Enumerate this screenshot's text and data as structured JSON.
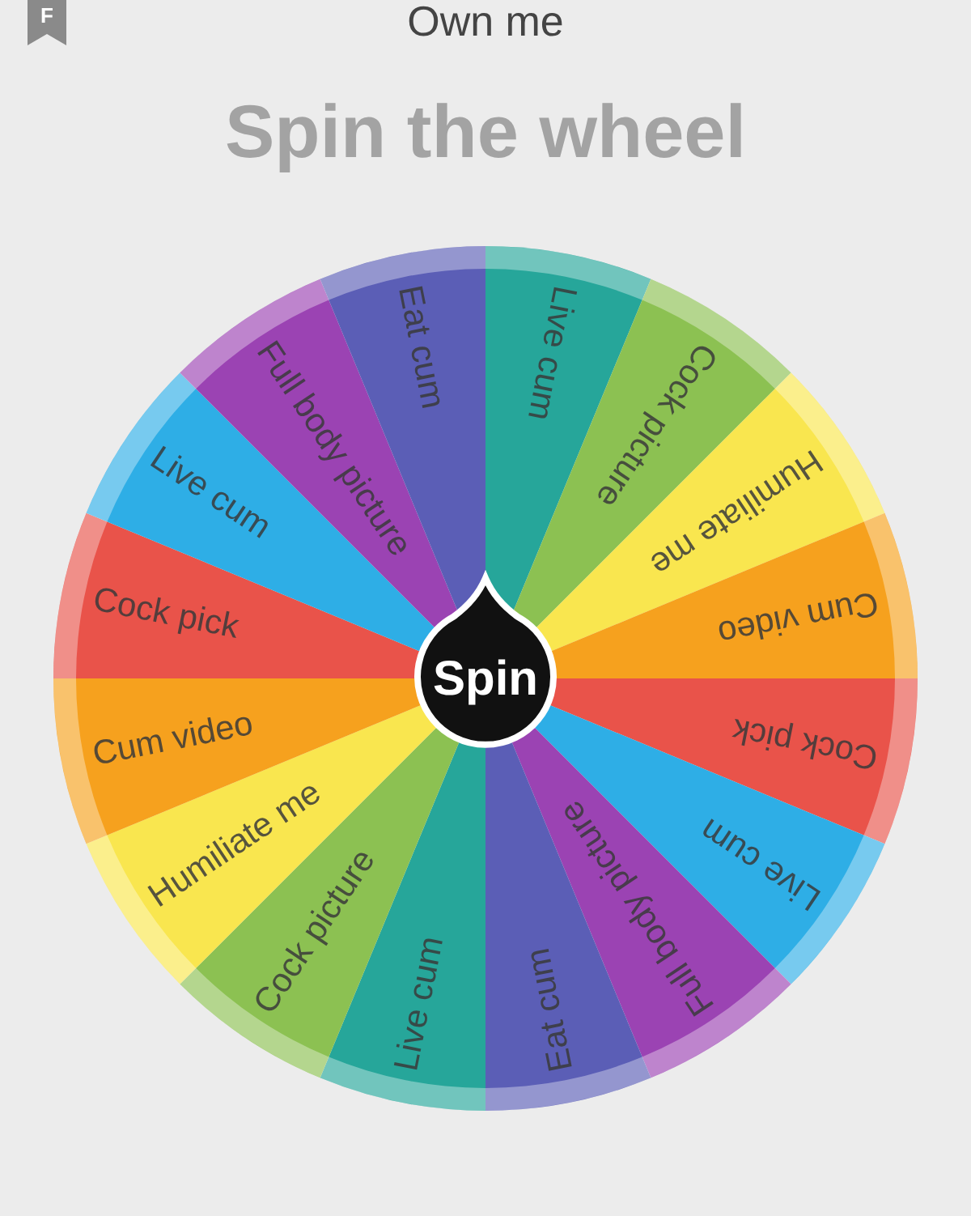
{
  "bookmark": "F",
  "title": "Own me",
  "heading": "Spin the wheel",
  "wheel": {
    "spin_button": "Spin",
    "segments": [
      {
        "label": "Live cum",
        "color": "#26a69a"
      },
      {
        "label": "Cock picture",
        "color": "#8cc152"
      },
      {
        "label": "Humiliate me",
        "color": "#f9e64f"
      },
      {
        "label": "Cum video",
        "color": "#f6a11e"
      },
      {
        "label": "Cock pick",
        "color": "#e9534a"
      },
      {
        "label": "Live cum",
        "color": "#2eaee6"
      },
      {
        "label": "Full body picture",
        "color": "#9b43b3"
      },
      {
        "label": "Eat cum",
        "color": "#5b5eb6"
      },
      {
        "label": "Live cum",
        "color": "#26a69a"
      },
      {
        "label": "Cock picture",
        "color": "#8cc152"
      },
      {
        "label": "Humiliate me",
        "color": "#f9e64f"
      },
      {
        "label": "Cum video",
        "color": "#f6a11e"
      },
      {
        "label": "Cock pick",
        "color": "#e9534a"
      },
      {
        "label": "Live cum",
        "color": "#2eaee6"
      },
      {
        "label": "Full body picture",
        "color": "#9b43b3"
      },
      {
        "label": "Eat cum",
        "color": "#5b5eb6"
      }
    ]
  }
}
